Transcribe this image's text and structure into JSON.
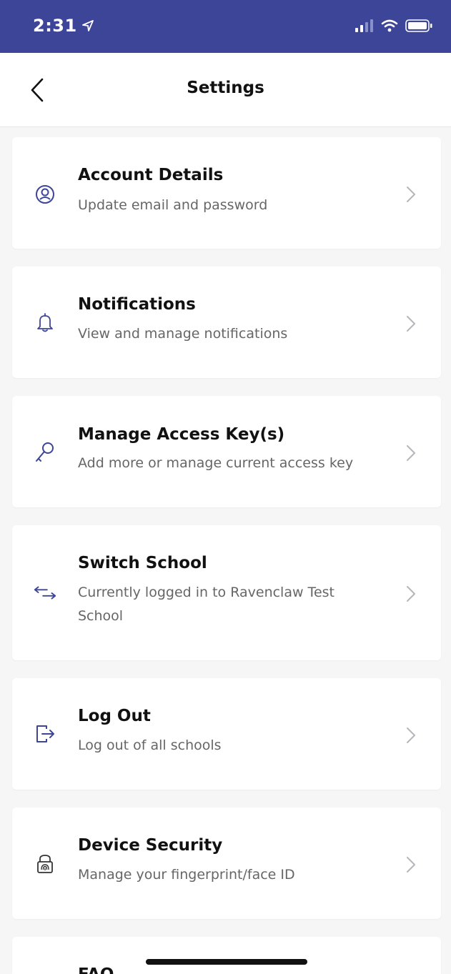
{
  "status_bar": {
    "time": "2:31",
    "background": "#3d4599"
  },
  "header": {
    "title": "Settings",
    "back_icon": "chevron-left-icon"
  },
  "settings": [
    {
      "id": "account-details",
      "icon": "user-circle-icon",
      "title": "Account Details",
      "subtitle": "Update email and password"
    },
    {
      "id": "notifications",
      "icon": "bell-icon",
      "title": "Notifications",
      "subtitle": "View and manage notifications"
    },
    {
      "id": "manage-access-keys",
      "icon": "key-icon",
      "title": "Manage Access Key(s)",
      "subtitle": "Add more or manage current access key"
    },
    {
      "id": "switch-school",
      "icon": "switch-arrows-icon",
      "title": "Switch School",
      "subtitle": "Currently logged in to Ravenclaw Test School"
    },
    {
      "id": "log-out",
      "icon": "logout-icon",
      "title": "Log Out",
      "subtitle": "Log out of all schools"
    },
    {
      "id": "device-security",
      "icon": "fingerprint-lock-icon",
      "title": "Device Security",
      "subtitle": "Manage your fingerprint/face ID"
    },
    {
      "id": "faq",
      "icon": "",
      "title": "FAQ",
      "subtitle": ""
    }
  ],
  "colors": {
    "accent": "#3d4599",
    "page_background": "#f6f6f7",
    "card_background": "#ffffff",
    "subtitle_text": "#666666",
    "chevron": "#b5b5bb"
  }
}
